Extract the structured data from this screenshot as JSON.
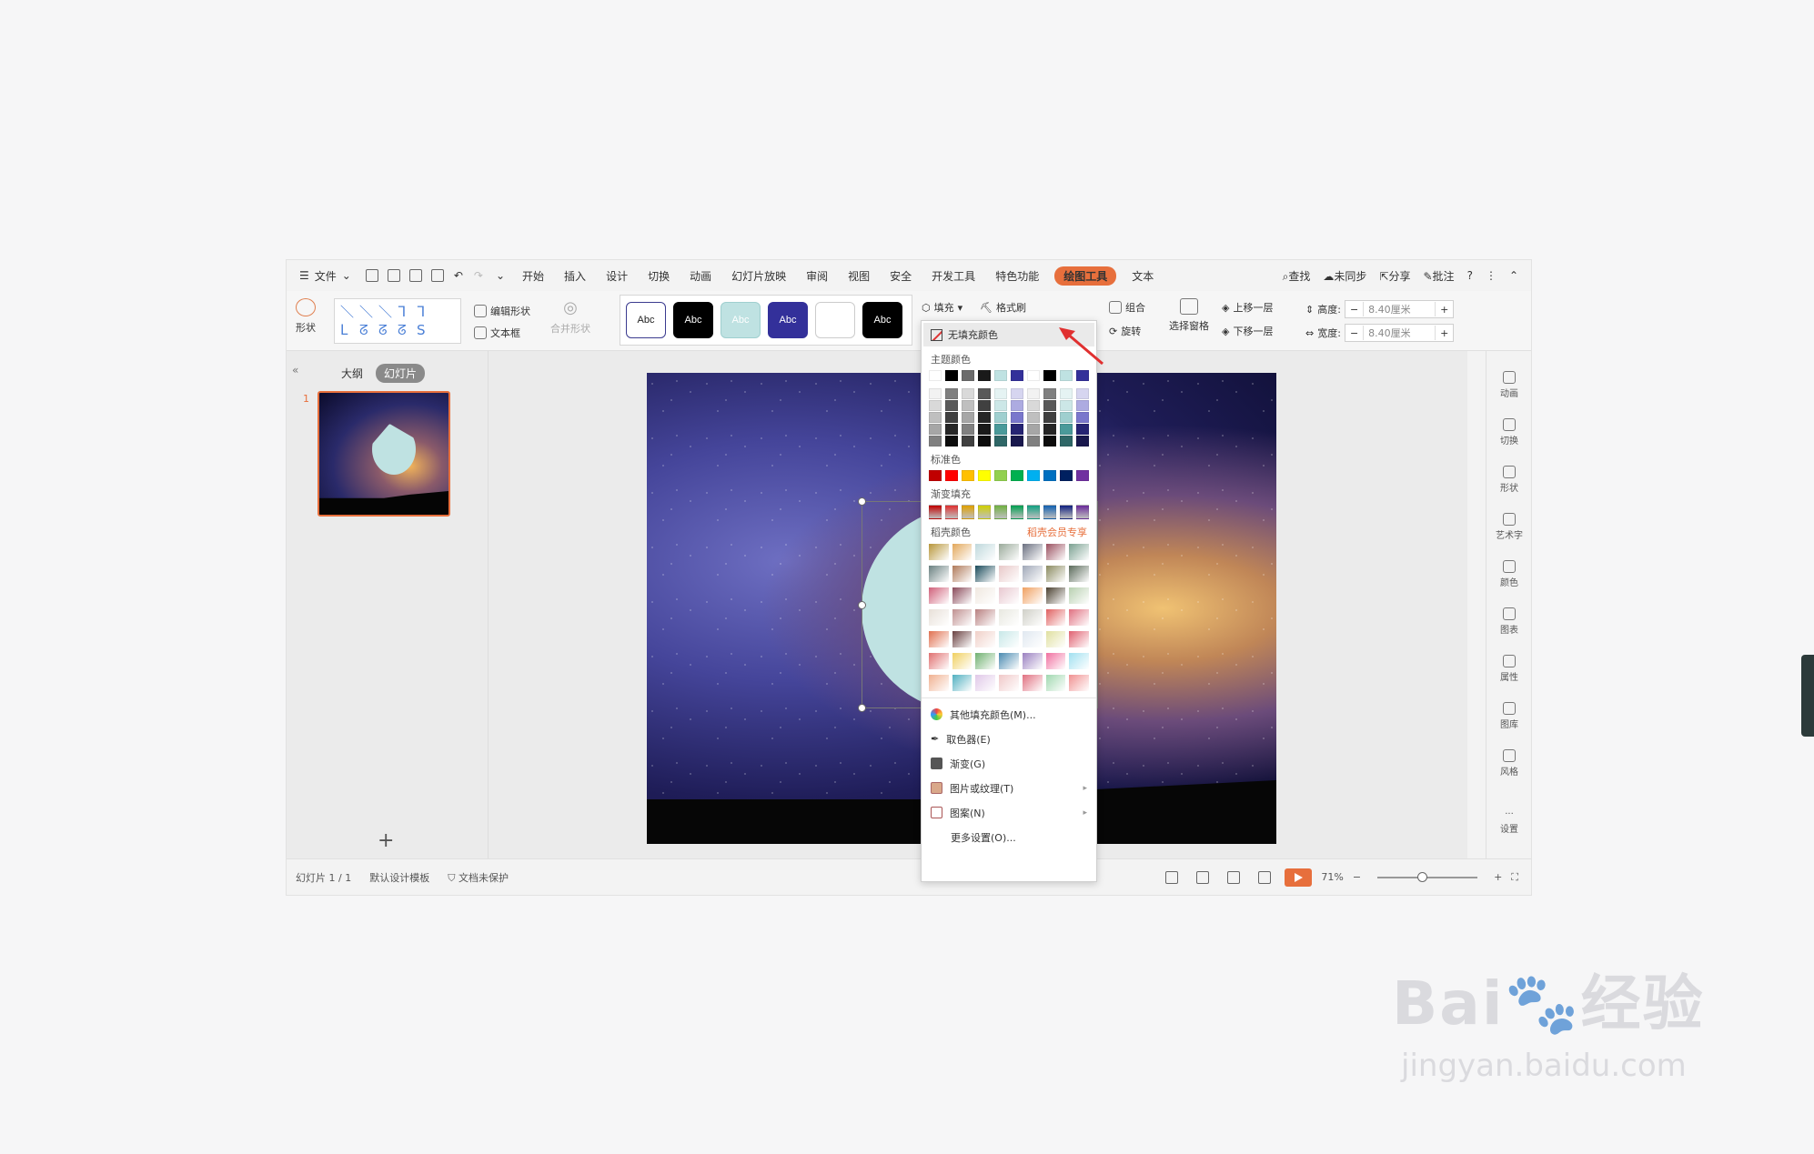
{
  "menubar": {
    "file_label": "文件",
    "tabs": [
      "开始",
      "插入",
      "设计",
      "切换",
      "动画",
      "幻灯片放映",
      "审阅",
      "视图",
      "安全",
      "开发工具",
      "特色功能"
    ],
    "active_tab": "绘图工具",
    "extra_tab": "文本",
    "search": "查找",
    "sync": "未同步",
    "share": "分享",
    "comment": "批注"
  },
  "ribbon": {
    "shape": "形状",
    "edit_shape": "编辑形状",
    "textbox": "文本框",
    "merge_shapes": "合并形状",
    "styles": [
      {
        "label": "Abc",
        "bg": "#ffffff",
        "fg": "#222",
        "border": "#3b3b8f"
      },
      {
        "label": "Abc",
        "bg": "#000000",
        "fg": "#ffffff",
        "border": "#000"
      },
      {
        "label": "Abc",
        "bg": "#bfe2e2",
        "fg": "#ffffff",
        "border": "#9fcfcf"
      },
      {
        "label": "Abc",
        "bg": "#33309a",
        "fg": "#ffffff",
        "border": "#33309a"
      },
      {
        "label": "",
        "bg": "#ffffff",
        "fg": "#222",
        "border": "#ccc"
      },
      {
        "label": "Abc",
        "bg": "#000000",
        "fg": "#ffffff",
        "border": "#000"
      }
    ],
    "fill": "填充",
    "format_painter": "格式刷",
    "group": "组合",
    "rotate": "旋转",
    "selection_pane": "选择窗格",
    "bring_forward": "上移一层",
    "send_backward": "下移一层",
    "height_label": "高度:",
    "height_value": "8.40厘米",
    "width_label": "宽度:",
    "width_value": "8.40厘米"
  },
  "left_panel": {
    "outline_tab": "大纲",
    "slides_tab": "幻灯片",
    "slide_number": "1",
    "add": "+"
  },
  "right_bar": [
    "动画",
    "切换",
    "形状",
    "艺术字",
    "颜色",
    "图表",
    "属性",
    "图库",
    "风格",
    "设置"
  ],
  "status": {
    "slide_info": "幻灯片 1 / 1",
    "template": "默认设计模板",
    "protect": "文档未保护",
    "zoom": "71%"
  },
  "dropdown": {
    "no_fill": "无填充颜色",
    "theme_colors": "主题颜色",
    "standard_colors": "标准色",
    "gradient_fill": "渐变填充",
    "daoke_colors": "稻壳颜色",
    "member_only": "稻壳会员专享",
    "theme_row": [
      "#ffffff",
      "#000000",
      "#6b6b6b",
      "#1a1a1a",
      "#bfe2e2",
      "#33309a",
      "#ffffff",
      "#000000",
      "#bfe2e2",
      "#33309a"
    ],
    "theme_cols": [
      [
        "#f2f2f2",
        "#d9d9d9",
        "#bfbfbf",
        "#a6a6a6",
        "#808080"
      ],
      [
        "#7f7f7f",
        "#595959",
        "#404040",
        "#262626",
        "#0d0d0d"
      ],
      [
        "#d9d9d9",
        "#bfbfbf",
        "#a6a6a6",
        "#808080",
        "#404040"
      ],
      [
        "#595959",
        "#404040",
        "#262626",
        "#1a1a1a",
        "#0d0d0d"
      ],
      [
        "#e5f3f3",
        "#cce7e7",
        "#9fcfcf",
        "#4a9a9a",
        "#2f6767"
      ],
      [
        "#d6d5f0",
        "#adabe1",
        "#7a77cc",
        "#262473",
        "#19184d"
      ],
      [
        "#f2f2f2",
        "#d9d9d9",
        "#bfbfbf",
        "#a6a6a6",
        "#808080"
      ],
      [
        "#7f7f7f",
        "#595959",
        "#404040",
        "#262626",
        "#0d0d0d"
      ],
      [
        "#e5f3f3",
        "#cce7e7",
        "#9fcfcf",
        "#4a9a9a",
        "#2f6767"
      ],
      [
        "#d6d5f0",
        "#adabe1",
        "#7a77cc",
        "#262473",
        "#19184d"
      ]
    ],
    "standard_row": [
      "#c00000",
      "#ff0000",
      "#ffc000",
      "#ffff00",
      "#92d050",
      "#00b050",
      "#00b0f0",
      "#0070c0",
      "#002060",
      "#7030a0"
    ],
    "gradient_row": [
      "#c00000",
      "#e03030",
      "#e0a000",
      "#d0d000",
      "#70b040",
      "#00a050",
      "#10a080",
      "#1060b0",
      "#102080",
      "#6a2a9a"
    ],
    "daoke_grid": [
      [
        "#b8963a",
        "#e2a75a",
        "#bfd8dc",
        "#9aaa9a",
        "#6b7080",
        "#9a5060",
        "#7aa090"
      ],
      [
        "#6a8080",
        "#b07a5a",
        "#1a4a5a",
        "#e8c8c8",
        "#a0a8b8",
        "#8a8a60",
        "#5a6a5a"
      ],
      [
        "#d0607a",
        "#8a4a5a",
        "#f0e8e0",
        "#e8c8d0",
        "#f0a060",
        "#4a4030",
        "#b8d0b0"
      ],
      [
        "#e8e0d8",
        "#c09090",
        "#b88080",
        "#e8e8e0",
        "#d0d0c8",
        "#e06060",
        "#e07080"
      ],
      [
        "#e07050",
        "#6a4040",
        "#f0d0c8",
        "#c8e8e8",
        "#e0e8f0",
        "#e0e0a0",
        "#e06070"
      ],
      [
        "#e07070",
        "#f0d060",
        "#70b070",
        "#4a8ab0",
        "#9a80c0",
        "#f070a0",
        "#a0e0f0"
      ],
      [
        "#f0b090",
        "#50b0c0",
        "#e0c8e8",
        "#f0c8c8",
        "#e07080",
        "#a0d8b0",
        "#f09090"
      ]
    ],
    "more_fill": "其他填充颜色(M)...",
    "eyedropper": "取色器(E)",
    "gradient": "渐变(G)",
    "picture_texture": "图片或纹理(T)",
    "pattern": "图案(N)",
    "more_settings": "更多设置(O)..."
  },
  "watermark": {
    "brand": "Bai",
    "brand2": "经验",
    "url": "jingyan.baidu.com"
  }
}
